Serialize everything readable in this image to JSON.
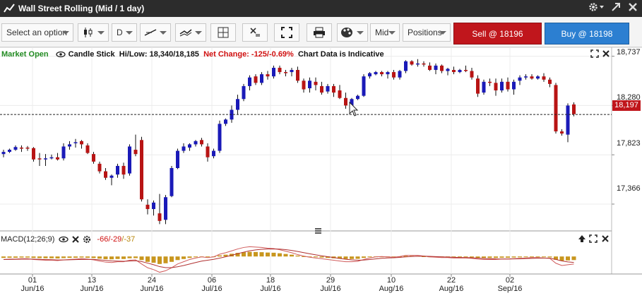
{
  "window": {
    "title": "Wall Street Rolling (Mid / 1 day)"
  },
  "toolbar": {
    "option_select": "Select an option",
    "interval": "D",
    "price_type": "Mid",
    "positions": "Positions",
    "sell_label": "Sell @ 18196",
    "buy_label": "Buy @ 18198"
  },
  "info": {
    "market_status": "Market Open",
    "chart_type": "Candle Stick",
    "hilow_label": "Hi/Low:",
    "hilow_value": "18,340/18,185",
    "net_change_label": "Net Change:",
    "net_change_value": "-125/-0.69%",
    "disclaimer": "Chart Data is Indicative"
  },
  "price_axis": {
    "ticks": [
      "18,737",
      "18,280",
      "17,823",
      "17,366"
    ],
    "current_price": "18,197"
  },
  "macd": {
    "label": "MACD(12;26;9)",
    "v1": "-66",
    "v2": "-29",
    "v3": "-37"
  },
  "x_axis": [
    {
      "day": "01",
      "month": "Jun/16"
    },
    {
      "day": "13",
      "month": "Jun/16"
    },
    {
      "day": "24",
      "month": "Jun/16"
    },
    {
      "day": "06",
      "month": "Jul/16"
    },
    {
      "day": "18",
      "month": "Jul/16"
    },
    {
      "day": "29",
      "month": "Jul/16"
    },
    {
      "day": "10",
      "month": "Aug/16"
    },
    {
      "day": "22",
      "month": "Aug/16"
    },
    {
      "day": "02",
      "month": "Sep/16"
    }
  ],
  "colors": {
    "up": "#1a1ab8",
    "down": "#b81414",
    "macd_hist": "#c8961e",
    "macd_line": "#d05a5a",
    "sell": "#c0161c",
    "buy": "#2c7fd1"
  },
  "chart_data": {
    "type": "candlestick",
    "price_ylim": [
      17150,
      18800
    ],
    "price_ticks": [
      18737,
      18280,
      17823,
      17366
    ],
    "current_price": 18197,
    "candles": [
      [
        17830,
        17870,
        17800,
        17850
      ],
      [
        17850,
        17880,
        17840,
        17870
      ],
      [
        17870,
        17910,
        17860,
        17895
      ],
      [
        17890,
        17910,
        17850,
        17880
      ],
      [
        17890,
        17905,
        17860,
        17885
      ],
      [
        17885,
        17895,
        17760,
        17780
      ],
      [
        17790,
        17840,
        17720,
        17780
      ],
      [
        17790,
        17830,
        17720,
        17790
      ],
      [
        17800,
        17825,
        17780,
        17800
      ],
      [
        17800,
        17840,
        17770,
        17780
      ],
      [
        17790,
        17930,
        17770,
        17900
      ],
      [
        17900,
        17950,
        17870,
        17920
      ],
      [
        17930,
        17970,
        17890,
        17940
      ],
      [
        17950,
        17960,
        17880,
        17920
      ],
      [
        17910,
        17930,
        17830,
        17840
      ],
      [
        17830,
        17850,
        17740,
        17760
      ],
      [
        17740,
        17760,
        17650,
        17670
      ],
      [
        17670,
        17700,
        17590,
        17610
      ],
      [
        17610,
        17640,
        17540,
        17630
      ],
      [
        17640,
        17740,
        17610,
        17720
      ],
      [
        17720,
        17750,
        17600,
        17640
      ],
      [
        17650,
        17920,
        17630,
        17900
      ],
      [
        17870,
        18010,
        17810,
        17830
      ],
      [
        17960,
        17990,
        17390,
        17410
      ],
      [
        17360,
        17410,
        17270,
        17320
      ],
      [
        17320,
        17400,
        17260,
        17380
      ],
      [
        17280,
        17460,
        17180,
        17210
      ],
      [
        17220,
        17450,
        17180,
        17430
      ],
      [
        17440,
        17720,
        17430,
        17700
      ],
      [
        17700,
        17880,
        17690,
        17860
      ],
      [
        17860,
        17930,
        17840,
        17900
      ],
      [
        17890,
        17930,
        17860,
        17920
      ],
      [
        17920,
        17960,
        17900,
        17950
      ],
      [
        17960,
        17980,
        17900,
        17920
      ],
      [
        17900,
        17930,
        17760,
        17800
      ],
      [
        17810,
        17880,
        17790,
        17860
      ],
      [
        17860,
        18140,
        17840,
        18110
      ],
      [
        18110,
        18160,
        18090,
        18150
      ],
      [
        18150,
        18280,
        18120,
        18240
      ],
      [
        18240,
        18380,
        18200,
        18340
      ],
      [
        18340,
        18480,
        18320,
        18460
      ],
      [
        18460,
        18560,
        18420,
        18540
      ],
      [
        18550,
        18570,
        18470,
        18490
      ],
      [
        18490,
        18590,
        18470,
        18570
      ],
      [
        18570,
        18600,
        18520,
        18550
      ],
      [
        18550,
        18650,
        18530,
        18630
      ],
      [
        18630,
        18650,
        18570,
        18590
      ],
      [
        18590,
        18610,
        18550,
        18580
      ],
      [
        18590,
        18630,
        18550,
        18610
      ],
      [
        18610,
        18640,
        18490,
        18510
      ],
      [
        18510,
        18530,
        18400,
        18430
      ],
      [
        18440,
        18540,
        18400,
        18510
      ],
      [
        18500,
        18540,
        18420,
        18470
      ],
      [
        18460,
        18500,
        18380,
        18400
      ],
      [
        18410,
        18480,
        18390,
        18460
      ],
      [
        18460,
        18480,
        18360,
        18400
      ],
      [
        18420,
        18470,
        18340,
        18350
      ],
      [
        18350,
        18400,
        18250,
        18280
      ],
      [
        18280,
        18350,
        18250,
        18340
      ],
      [
        18340,
        18380,
        18330,
        18370
      ],
      [
        18370,
        18570,
        18360,
        18550
      ],
      [
        18550,
        18590,
        18530,
        18580
      ],
      [
        18570,
        18600,
        18560,
        18590
      ],
      [
        18590,
        18600,
        18550,
        18570
      ],
      [
        18570,
        18600,
        18530,
        18590
      ],
      [
        18590,
        18610,
        18520,
        18540
      ],
      [
        18540,
        18610,
        18520,
        18600
      ],
      [
        18600,
        18700,
        18580,
        18690
      ],
      [
        18690,
        18700,
        18650,
        18660
      ],
      [
        18660,
        18710,
        18640,
        18670
      ],
      [
        18670,
        18690,
        18640,
        18660
      ],
      [
        18650,
        18680,
        18600,
        18610
      ],
      [
        18610,
        18670,
        18570,
        18650
      ],
      [
        18650,
        18660,
        18580,
        18600
      ],
      [
        18600,
        18630,
        18560,
        18620
      ],
      [
        18610,
        18640,
        18570,
        18590
      ],
      [
        18590,
        18620,
        18580,
        18610
      ],
      [
        18610,
        18650,
        18590,
        18600
      ],
      [
        18600,
        18630,
        18520,
        18540
      ],
      [
        18530,
        18560,
        18360,
        18390
      ],
      [
        18400,
        18520,
        18380,
        18500
      ],
      [
        18500,
        18530,
        18460,
        18490
      ],
      [
        18490,
        18530,
        18370,
        18420
      ],
      [
        18420,
        18530,
        18400,
        18500
      ],
      [
        18500,
        18540,
        18410,
        18430
      ],
      [
        18430,
        18520,
        18380,
        18500
      ],
      [
        18510,
        18560,
        18470,
        18540
      ],
      [
        18540,
        18570,
        18520,
        18550
      ],
      [
        18550,
        18570,
        18520,
        18530
      ],
      [
        18530,
        18560,
        18520,
        18550
      ],
      [
        18550,
        18580,
        18500,
        18520
      ],
      [
        18520,
        18540,
        18450,
        18480
      ],
      [
        18470,
        18490,
        18020,
        18040
      ],
      [
        18040,
        18060,
        18000,
        18020
      ],
      [
        18010,
        18300,
        17940,
        18280
      ],
      [
        18290,
        18310,
        18180,
        18200
      ]
    ],
    "macd_ylim": [
      -90,
      60
    ],
    "macd_hist": [
      -8,
      -7,
      -7,
      -6,
      -6,
      -8,
      -9,
      -10,
      -10,
      -11,
      -9,
      -8,
      -7,
      -6,
      -7,
      -9,
      -12,
      -15,
      -16,
      -14,
      -14,
      -10,
      -9,
      -20,
      -30,
      -35,
      -42,
      -38,
      -30,
      -20,
      -14,
      -8,
      -4,
      -1,
      -3,
      -1,
      6,
      10,
      15,
      20,
      24,
      26,
      25,
      24,
      22,
      21,
      18,
      14,
      10,
      5,
      1,
      -2,
      -4,
      -6,
      -8,
      -10,
      -12,
      -14,
      -14,
      -13,
      -8,
      -4,
      -1,
      0,
      -1,
      -2,
      0,
      3,
      3,
      3,
      1,
      -1,
      -2,
      -3,
      -3,
      -4,
      -4,
      -4,
      -5,
      -7,
      -8,
      -8,
      -8,
      -7,
      -7,
      -6,
      -5,
      -4,
      -3,
      -3,
      -4,
      -5,
      -18,
      -24,
      -22,
      -20
    ]
  }
}
